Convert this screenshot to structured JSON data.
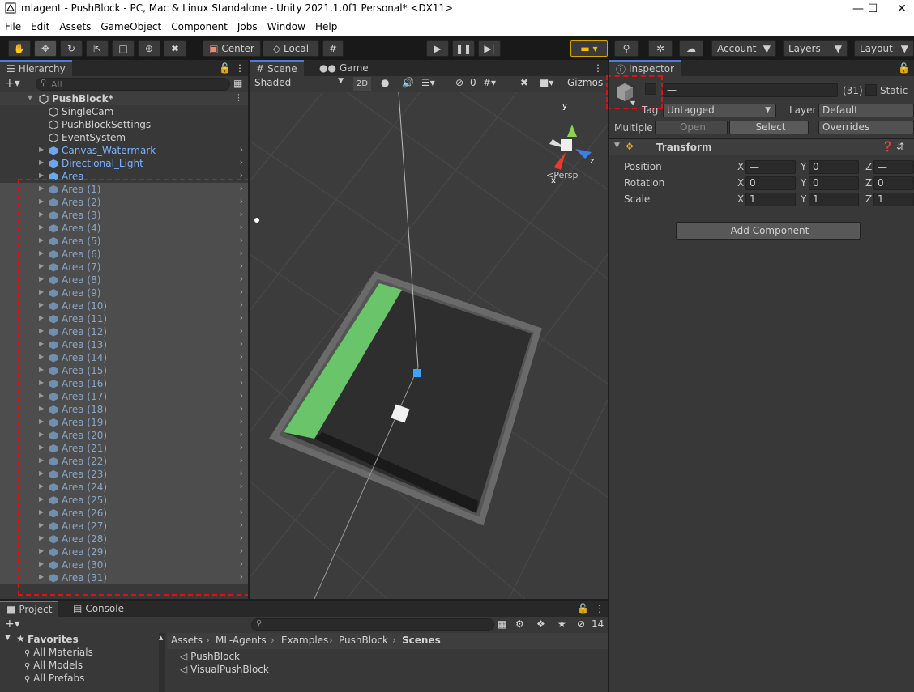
{
  "window": {
    "title": "mlagent - PushBlock - PC, Mac & Linux Standalone - Unity 2021.1.0f1 Personal* <DX11>"
  },
  "menu": [
    "File",
    "Edit",
    "Assets",
    "GameObject",
    "Component",
    "Jobs",
    "Window",
    "Help"
  ],
  "toolbar": {
    "pivot": "Center",
    "space": "Local",
    "account": "Account",
    "layers": "Layers",
    "layout": "Layout"
  },
  "hierarchy": {
    "tab": "Hierarchy",
    "search_placeholder": "All",
    "scene": "PushBlock*",
    "children": [
      {
        "name": "SingleCam",
        "prefab": false
      },
      {
        "name": "PushBlockSettings",
        "prefab": false
      },
      {
        "name": "EventSystem",
        "prefab": false
      },
      {
        "name": "Canvas_Watermark",
        "prefab": true
      },
      {
        "name": "Directional_Light",
        "prefab": true
      },
      {
        "name": "Area",
        "prefab": true
      }
    ],
    "selected_items": [
      "Area (1)",
      "Area (2)",
      "Area (3)",
      "Area (4)",
      "Area (5)",
      "Area (6)",
      "Area (7)",
      "Area (8)",
      "Area (9)",
      "Area (10)",
      "Area (11)",
      "Area (12)",
      "Area (13)",
      "Area (14)",
      "Area (15)",
      "Area (16)",
      "Area (17)",
      "Area (18)",
      "Area (19)",
      "Area (20)",
      "Area (21)",
      "Area (22)",
      "Area (23)",
      "Area (24)",
      "Area (25)",
      "Area (26)",
      "Area (27)",
      "Area (28)",
      "Area (29)",
      "Area (30)",
      "Area (31)"
    ]
  },
  "scene": {
    "tabs": [
      "Scene",
      "Game"
    ],
    "shading": "Shaded",
    "mode_2d": "2D",
    "hidden_count": "0",
    "gizmos": "Gizmos",
    "persp": "Persp",
    "axes": {
      "x": "x",
      "y": "y",
      "z": "z"
    }
  },
  "inspector": {
    "tab": "Inspector",
    "name_value": "—",
    "count": "(31)",
    "static": "Static",
    "tag_label": "Tag",
    "tag_value": "Untagged",
    "layer_label": "Layer",
    "layer_value": "Default",
    "multiple": "Multiple",
    "open": "Open",
    "select": "Select",
    "overrides": "Overrides",
    "transform": "Transform",
    "rows": [
      {
        "label": "Position",
        "x": "—",
        "y": "0",
        "z": "—"
      },
      {
        "label": "Rotation",
        "x": "0",
        "y": "0",
        "z": "0"
      },
      {
        "label": "Scale",
        "x": "1",
        "y": "1",
        "z": "1"
      }
    ],
    "add_component": "Add Component"
  },
  "project": {
    "tabs": [
      "Project",
      "Console"
    ],
    "hidden_count": "14",
    "favorites": "Favorites",
    "favorite_items": [
      "All Materials",
      "All Models",
      "All Prefabs"
    ],
    "breadcrumb": [
      "Assets",
      "ML-Agents",
      "Examples",
      "PushBlock",
      "Scenes"
    ],
    "files": [
      "PushBlock",
      "VisualPushBlock"
    ]
  },
  "colors": {
    "accent": "#4c7cd8",
    "selection": "#4d4d4d",
    "prefab_text": "#7ab3ff",
    "highlight": "#e01010"
  }
}
